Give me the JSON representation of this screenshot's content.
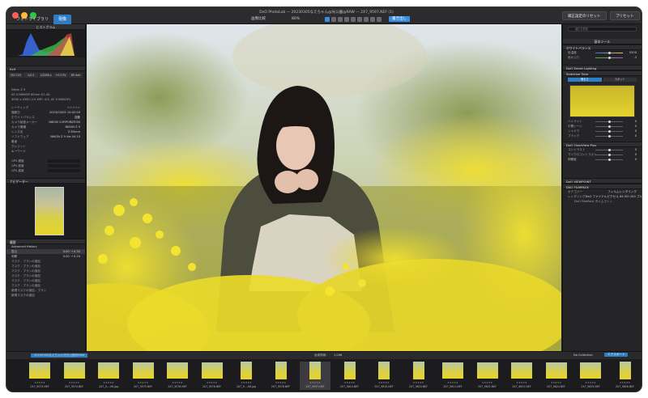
{
  "window": {
    "title": "DxO PhotoLab — 20230305なえちゃん@光公園@RAW — 2X7_9597.NEF (1)"
  },
  "tabs": [
    {
      "label": "フォトライブラリ"
    },
    {
      "label": "現像"
    }
  ],
  "toolbar": {
    "compare_label": "画像比較",
    "zoom_label": "80%",
    "export_button": "書き出し",
    "right_buttons": [
      "補正設定のリセット",
      "プリセット"
    ]
  },
  "left_panel": {
    "histogram_title": "ヒストグラム",
    "exif_title": "Exif",
    "exif_shooting": [
      "ISO 125",
      "1/4 0",
      "1/2000 s",
      "+0.3 EV",
      "85 mm"
    ],
    "exif_lens": "Nikon Z 9",
    "exif_lens2": "AF-S NIKKOR 85mm f/1.4G",
    "exif_info": "3000 x 4390 (13.1MP, 4:3, AF-S NIKKOR)",
    "meta_rows": [
      {
        "label": "レーティング",
        "value": "☆☆☆☆☆"
      },
      {
        "label": "撮影日",
        "value": "2023/03/05 15:02:59"
      },
      {
        "label": "ホワイトバランス",
        "value": "自動"
      },
      {
        "label": "カメラ製造メーカー",
        "value": "NIKON CORPORATION"
      },
      {
        "label": "カメラ機種",
        "value": "NIKON Z 9"
      },
      {
        "label": "レンズ名",
        "value": "Z 85mm"
      },
      {
        "label": "ソフトウェア",
        "value": "NIKON Z 9 Ver.04.10"
      },
      {
        "label": "著者",
        "value": ""
      },
      {
        "label": "クレジット",
        "value": ""
      },
      {
        "label": "キーワード",
        "value": ""
      }
    ],
    "gps_rows": [
      "GPS 緯度",
      "GPS 経度",
      "GPS 高度"
    ],
    "nav_title": "ナビゲーター",
    "history_title": "履歴",
    "history_header": "Advanced History",
    "history_items": [
      {
        "label": "露出",
        "value": "0.00 → 0.30"
      },
      {
        "label": "明瞭",
        "value": "0.00 → 0.20"
      },
      {
        "label": "マスク - ブラシの追加",
        "value": ""
      },
      {
        "label": "マスク - ブラシの追加",
        "value": ""
      },
      {
        "label": "マスク - ブラシの追加",
        "value": ""
      },
      {
        "label": "マスク - ブラシの追加",
        "value": ""
      },
      {
        "label": "マスク - ブラシの追加",
        "value": ""
      },
      {
        "label": "マスク - ブラシの追加",
        "value": ""
      },
      {
        "label": "新規マスクの追加 - ブラシ",
        "value": ""
      },
      {
        "label": "新規マスクの追加",
        "value": ""
      }
    ]
  },
  "right_panel": {
    "search_placeholder": "補正を検索",
    "basic_tools": "基本ツール",
    "sections": [
      "ホワイトバランス",
      "DxO Smart Lighting",
      "Selective Tone",
      "DxO ClearView Plus"
    ],
    "wb_rows": [
      {
        "label": "色温度",
        "value": "5200"
      },
      {
        "label": "色かぶり",
        "value": "-3"
      }
    ],
    "tone_tabs": [
      "明るさ",
      "スポット"
    ],
    "tone_rows": [
      {
        "label": "ハイライト",
        "value": "0"
      },
      {
        "label": "中間トーン",
        "value": "0"
      },
      {
        "label": "シャドウ",
        "value": "0"
      },
      {
        "label": "ブラック",
        "value": "0"
      }
    ],
    "contrast_rows": [
      {
        "label": "コントラスト",
        "value": "0"
      },
      {
        "label": "マイクロコントラスト",
        "value": "0"
      },
      {
        "label": "明瞭度",
        "value": "0"
      }
    ],
    "lower_sections": [
      "DxO VIEWPOINT",
      "DXO FILMPACK"
    ],
    "filmpack_rows": [
      {
        "label": "カテゴリー",
        "value": "フィルムレンダリング"
      },
      {
        "label": "レンダリング",
        "value": "DxO ファイナルピクセル 64 ISO 200 ブルー"
      }
    ],
    "filmpack_extra": "DxO FilmPack タイムマシン"
  },
  "filmbar": {
    "folder": "20230305なえちゃん@光公園@RAW",
    "center_text": "画像情報：",
    "center_value": "1,006",
    "right_label": "No Collection",
    "export_label": "エクスポート"
  },
  "filmstrip": [
    {
      "name": "2X7_9573.NEF",
      "v": false
    },
    {
      "name": "2X7_9574.NEF",
      "v": false
    },
    {
      "name": "2X7_9...-06.jpg",
      "v": false
    },
    {
      "name": "2X7_9575.NEF",
      "v": false
    },
    {
      "name": "2X7_9576.NEF",
      "v": false
    },
    {
      "name": "2X7_9578.NEF",
      "v": false
    },
    {
      "name": "2X7_9...-06.jpg",
      "v": true
    },
    {
      "name": "2X7_9578.NEF",
      "v": true
    },
    {
      "name": "2X7_9597.NEF",
      "v": true,
      "sel": true
    },
    {
      "name": "2X7_9610.NEF",
      "v": true
    },
    {
      "name": "2X7_9615.NEF",
      "v": true
    },
    {
      "name": "2X7_9620.NEF",
      "v": true
    },
    {
      "name": "2X7_9621.NEF",
      "v": false
    },
    {
      "name": "2X7_9622.NEF",
      "v": false
    },
    {
      "name": "2X7_9623.NEF",
      "v": false
    },
    {
      "name": "2X7_9624.NEF",
      "v": false
    },
    {
      "name": "2X7_9625.NEF",
      "v": false
    },
    {
      "name": "2X7_9626.NEF",
      "v": true
    }
  ],
  "colors": {
    "accent": "#2f7ec4",
    "panel": "#252527",
    "yellow_flowers": "#e6d52a"
  }
}
